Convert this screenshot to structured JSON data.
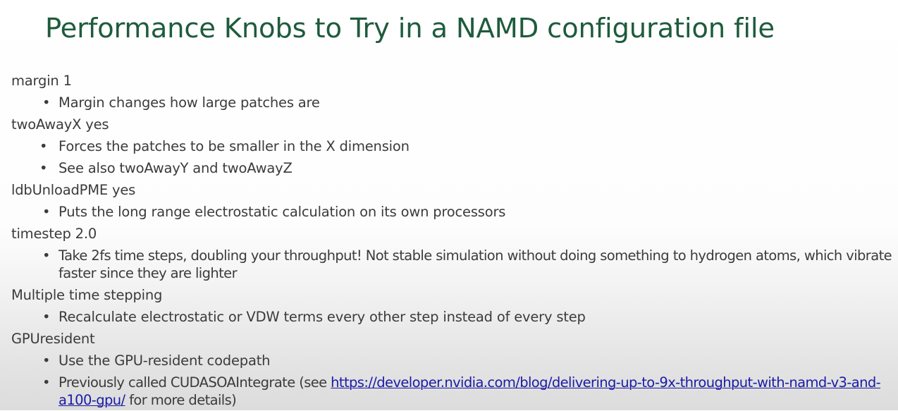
{
  "title": "Performance Knobs to Try in a NAMD configuration file",
  "sections": [
    {
      "heading": "margin 1",
      "bullets": [
        "Margin changes how large patches are"
      ]
    },
    {
      "heading": "twoAwayX yes",
      "bullets": [
        "Forces the patches to be smaller in the X dimension",
        "See also twoAwayY and twoAwayZ"
      ]
    },
    {
      "heading": "ldbUnloadPME yes",
      "bullets": [
        "Puts the long range electrostatic calculation on its own processors"
      ]
    },
    {
      "heading": "timestep 2.0",
      "bullets": [
        "Take 2fs time steps, doubling your throughput! Not stable simulation without doing something to hydrogen atoms, which vibrate faster since they are lighter"
      ]
    },
    {
      "heading": "Multiple time stepping",
      "bullets": [
        "Recalculate electrostatic or VDW terms every other step instead of every step"
      ]
    },
    {
      "heading": "GPUresident",
      "bullets": [
        "Use the GPU-resident codepath"
      ]
    }
  ],
  "last_bullet": {
    "prefix": "Previously called CUDASOAIntegrate (see ",
    "link_text": "https://developer.nvidia.com/blog/delivering-up-to-9x-throughput-with-namd-v3-and-a100-gpu/",
    "suffix": " for more details)"
  },
  "bullet_glyph": "•",
  "colors": {
    "title": "#1e5b3c",
    "text": "#3b3b3b",
    "link": "#1a1aa6"
  }
}
